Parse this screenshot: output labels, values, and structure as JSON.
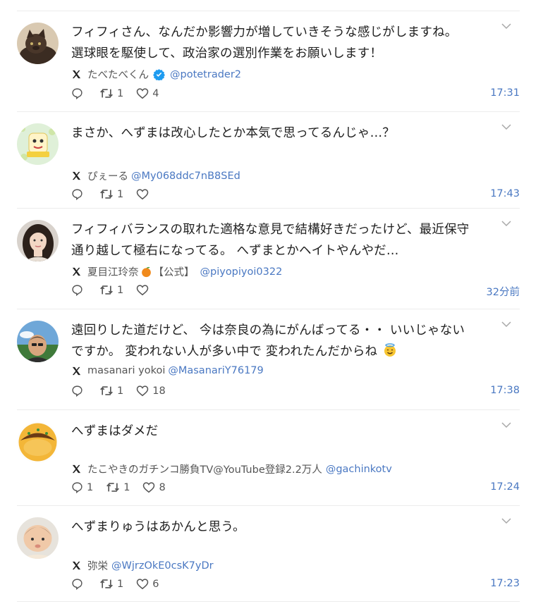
{
  "posts": [
    {
      "text": "フィフィさん、なんだか影響力が増していきそうな感じがしますね。選球眼を駆使して、政治家の選別作業をお願いします！",
      "author": "たべたべくん",
      "handle": "@potetrader2",
      "verified": true,
      "replies": "",
      "retweets": "1",
      "likes": "4",
      "time": "17:31",
      "avatar": "cat-avatar"
    },
    {
      "text": "まさか、へずまは改心したとか本気で思ってるんじゃ…？",
      "author": "ぴぇーる",
      "handle": "@My068ddc7nB8SEd",
      "replies": "",
      "retweets": "1",
      "likes": "",
      "time": "17:43",
      "avatar": "illustration-avatar"
    },
    {
      "text": "フィフィバランスの取れた適格な意見で結構好きだったけど、最近保守通り越して極右になってる。 へずまとかヘイトやんやだ…",
      "author": "夏目江玲奈",
      "author_suffix": "【公式】",
      "handle": "@piyopiyoi0322",
      "replies": "",
      "retweets": "1",
      "likes": "",
      "time": "32分前",
      "avatar": "woman-avatar"
    },
    {
      "text": "遠回りした道だけど、 今は奈良の為にがんばってる・・ いいじゃないですか。 変われない人が多い中で 変われたんだからね",
      "author": "masanari yokoi",
      "handle": "@MasanariY76179",
      "replies": "",
      "retweets": "1",
      "likes": "18",
      "time": "17:38",
      "avatar": "man-avatar"
    },
    {
      "text": "へずまはダメだ",
      "author": "たこやきのガチンコ勝負TV@YouTube登録2.2万人",
      "handle": "@gachinkotv",
      "replies": "1",
      "retweets": "1",
      "likes": "8",
      "time": "17:24",
      "avatar": "takoyaki-avatar"
    },
    {
      "text": "へずまりゅうはあかんと思う。",
      "author": "弥栄",
      "handle": "@WjrzOkE0csK7yDr",
      "replies": "",
      "retweets": "1",
      "likes": "6",
      "time": "17:23",
      "avatar": "baby-avatar"
    }
  ],
  "colors": {
    "accent": "#4a78c2",
    "verified": "#1d9bf0",
    "text": "#1f1f1f",
    "muted": "#555555",
    "divider": "#ececec"
  }
}
